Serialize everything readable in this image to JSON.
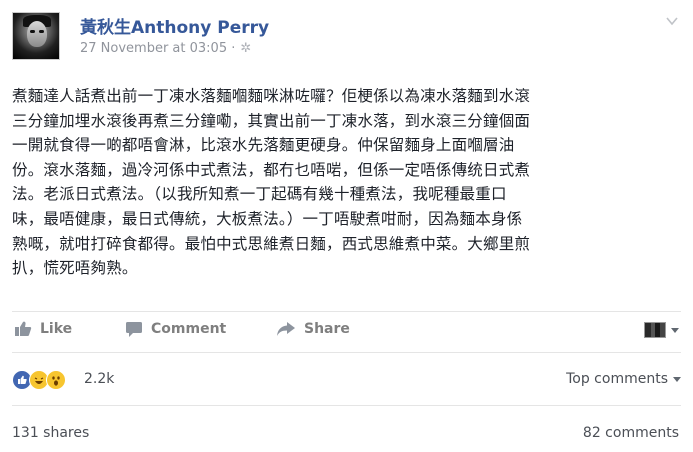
{
  "post": {
    "author": "黃秋生Anthony Perry",
    "timestamp": "27 November at 03:05 ·",
    "text": "煮麵達人話煮出前一丁凍水落麵嗰麵咪淋咗囉？佢梗係以為凍水落麵到水滾\n三分鐘加埋水滾後再煮三分鐘嘞，其實出前一丁凍水落，到水滾三分鐘個面\n一開就食得一啲都唔會淋，比滾水先落麵更硬身。仲保留麵身上面嗰層油\n份。滾水落麵，過冷河係中式煮法，都冇乜唔啱，但係一定唔係傳统日式煮\n法。老派日式煮法。（以我所知煮一丁起碼有幾十種煮法，我呢種最重口\n味，最唔健康，最日式傳統，大板煮法。）一丁唔駛煮咁耐，因為麵本身係\n熟嘅，就咁打碎食都得。最怕中式思維煮日麵，西式思維煮中菜。大鄉里煎\n扒，慌死唔夠熟。"
  },
  "actions": {
    "like_label": "Like",
    "comment_label": "Comment",
    "share_label": "Share"
  },
  "reactions": {
    "icons": [
      "like-icon",
      "haha-icon",
      "wow-icon"
    ],
    "count": "2.2k",
    "sort_label": "Top comments"
  },
  "stats": {
    "shares": "131 shares",
    "comments": "82 comments"
  },
  "colors": {
    "author": "#365899",
    "meta": "#90949c",
    "action": "#7f7f7f",
    "like_reaction": "#4267b2",
    "emoji_reaction": "#f7c52f"
  }
}
